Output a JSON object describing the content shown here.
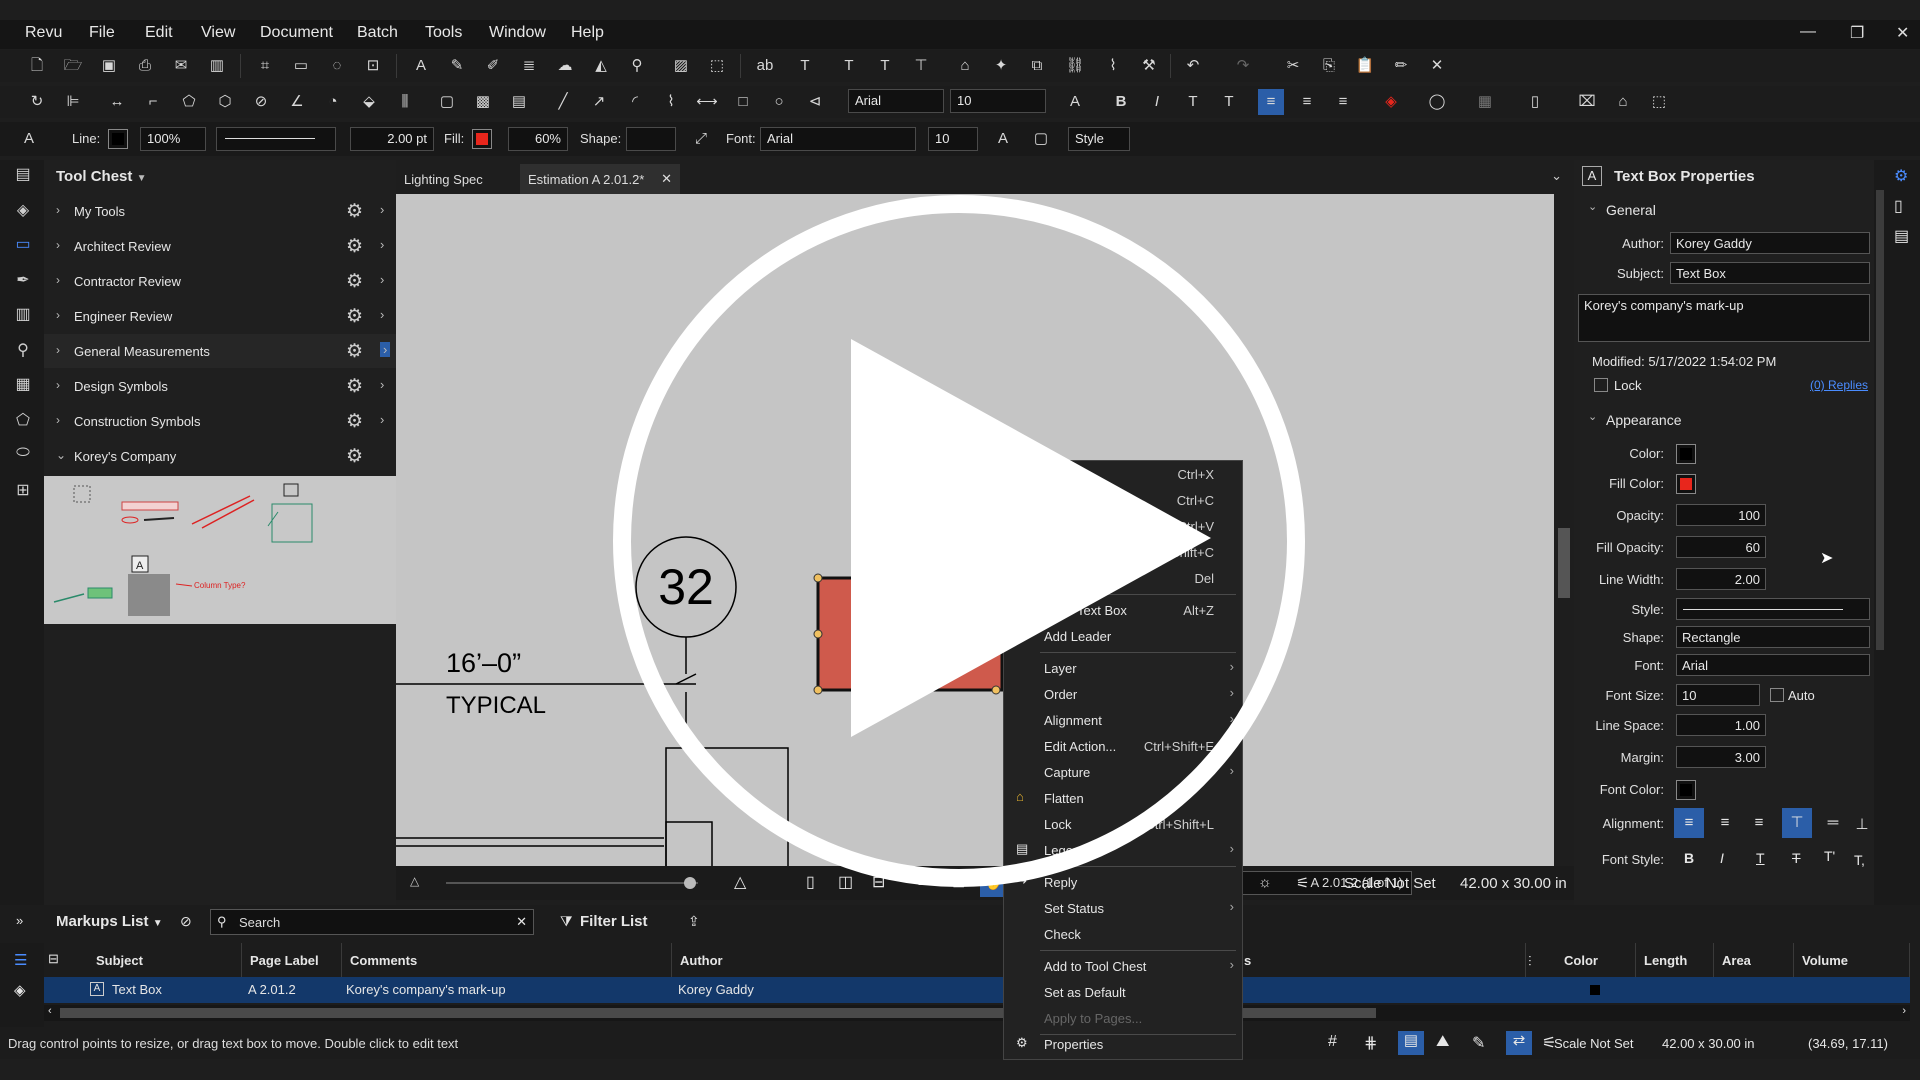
{
  "menubar": {
    "items": [
      "Revu",
      "File",
      "Edit",
      "View",
      "Document",
      "Batch",
      "Tools",
      "Window",
      "Help"
    ]
  },
  "window_controls": {
    "minimize": "—",
    "restore": "❐",
    "close": "✕"
  },
  "props_bar": {
    "line_label": "Line:",
    "line_opacity": "100%",
    "line_width": "2.00 pt",
    "fill_label": "Fill:",
    "fill_opacity": "60%",
    "shape_label": "Shape:",
    "font_label": "Font:",
    "font": "Arial",
    "font_size": "10",
    "style_label": "Style"
  },
  "format_bar": {
    "font": "Arial",
    "font_size": "10"
  },
  "tool_chest": {
    "title": "Tool Chest",
    "items": [
      {
        "label": "My Tools"
      },
      {
        "label": "Architect Review"
      },
      {
        "label": "Contractor Review"
      },
      {
        "label": "Engineer Review"
      },
      {
        "label": "General Measurements"
      },
      {
        "label": "Design Symbols"
      },
      {
        "label": "Construction Symbols"
      },
      {
        "label": "Korey's Company"
      }
    ],
    "preview_labels": [
      "Column Type?"
    ]
  },
  "tabs": [
    {
      "label": "Lighting Spec"
    },
    {
      "label": "Estimation A 2.01.2*"
    }
  ],
  "drawing": {
    "grid_bubble": "32",
    "dimension": "16’–0”",
    "note": "TYPICAL"
  },
  "canvas_bar": {
    "page_label": "A 2.01.2 (1 of 1)",
    "scale": "Scale Not Set",
    "size": "42.00 x 30.00 in"
  },
  "context_menu": {
    "items": [
      {
        "label": "",
        "shortcut": "Ctrl+X"
      },
      {
        "label": "",
        "shortcut": "Ctrl+C"
      },
      {
        "label": "",
        "shortcut": "Ctrl+V"
      },
      {
        "label": "",
        "shortcut": "Shift+C"
      },
      {
        "label": "",
        "shortcut": "Del"
      },
      {
        "label": "…ize Text Box",
        "shortcut": "Alt+Z"
      },
      {
        "label": "Add Leader",
        "shortcut": ""
      },
      {
        "label": "Layer",
        "shortcut": ""
      },
      {
        "label": "Order",
        "shortcut": ""
      },
      {
        "label": "Alignment",
        "shortcut": ""
      },
      {
        "label": "Edit Action...",
        "shortcut": "Ctrl+Shift+E"
      },
      {
        "label": "Capture",
        "shortcut": ""
      },
      {
        "label": "Flatten",
        "shortcut": ""
      },
      {
        "label": "Lock",
        "shortcut": "Ctrl+Shift+L"
      },
      {
        "label": "Legend",
        "shortcut": ""
      },
      {
        "label": "Reply",
        "shortcut": ""
      },
      {
        "label": "Set Status",
        "shortcut": ""
      },
      {
        "label": "Check",
        "shortcut": ""
      },
      {
        "label": "Add to Tool Chest",
        "shortcut": ""
      },
      {
        "label": "Set as Default",
        "shortcut": ""
      },
      {
        "label": "Apply to Pages...",
        "shortcut": ""
      },
      {
        "label": "Properties",
        "shortcut": ""
      }
    ]
  },
  "properties": {
    "title": "Text Box Properties",
    "general_label": "General",
    "author_label": "Author:",
    "author": "Korey Gaddy",
    "subject_label": "Subject:",
    "subject": "Text Box",
    "comment": "Korey's company's mark-up",
    "modified": "Modified: 5/17/2022 1:54:02 PM",
    "lock_label": "Lock",
    "replies": "(0) Replies",
    "appearance_label": "Appearance",
    "color_label": "Color:",
    "fill_color_label": "Fill Color:",
    "opacity_label": "Opacity:",
    "opacity": "100",
    "fill_opacity_label": "Fill Opacity:",
    "fill_opacity": "60",
    "line_width_label": "Line Width:",
    "line_width": "2.00",
    "style_label": "Style:",
    "shape_label": "Shape:",
    "shape": "Rectangle",
    "font_label": "Font:",
    "font": "Arial",
    "font_size_label": "Font Size:",
    "font_size": "10",
    "auto_label": "Auto",
    "line_space_label": "Line Space:",
    "line_space": "1.00",
    "margin_label": "Margin:",
    "margin": "3.00",
    "font_color_label": "Font Color:",
    "alignment_label": "Alignment:",
    "font_style_label": "Font Style:",
    "colors": {
      "color": "#000000",
      "fill": "#e8261c",
      "font_color": "#000000"
    }
  },
  "markups": {
    "title": "Markups List",
    "search_placeholder": "Search",
    "filter_label": "Filter List",
    "columns": [
      "Subject",
      "Page Label",
      "Comments",
      "Author",
      "s",
      "Color",
      "Length",
      "Area",
      "Volume"
    ],
    "rows": [
      {
        "subject": "Text Box",
        "page": "A 2.01.2",
        "comments": "Korey's company's mark-up",
        "author": "Korey Gaddy"
      }
    ]
  },
  "status": {
    "hint": "Drag control points to resize, or drag text box to move. Double click to edit text",
    "scale": "Scale Not Set",
    "size": "42.00 x 30.00 in",
    "coords": "(34.69, 17.11)"
  }
}
